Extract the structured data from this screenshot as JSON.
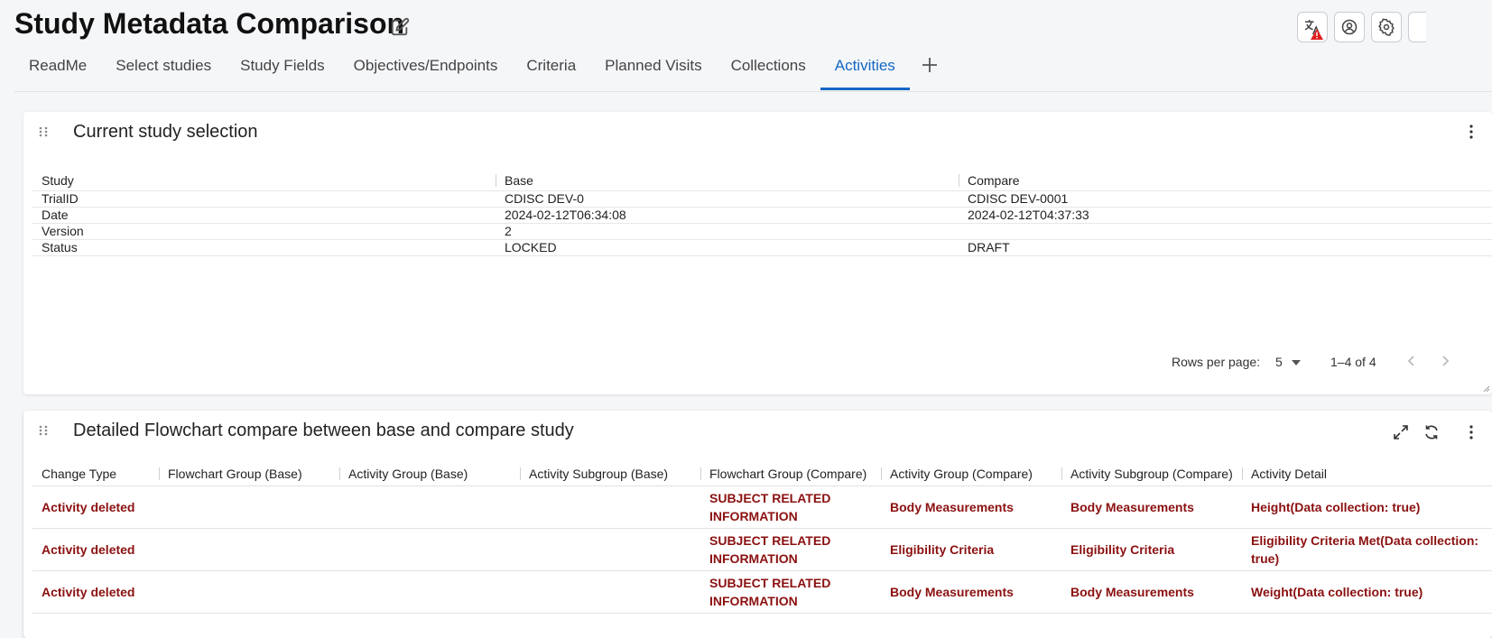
{
  "page": {
    "title": "Study Metadata Comparison"
  },
  "tabs": [
    {
      "label": "ReadMe"
    },
    {
      "label": "Select studies"
    },
    {
      "label": "Study Fields"
    },
    {
      "label": "Objectives/Endpoints"
    },
    {
      "label": "Criteria"
    },
    {
      "label": "Planned Visits"
    },
    {
      "label": "Collections"
    },
    {
      "label": "Activities"
    }
  ],
  "active_tab": "Activities",
  "icons": {
    "edit": "pencil-icon",
    "translate": "translate-icon",
    "account": "account-icon",
    "settings": "gear-icon",
    "add_tab": "plus-icon",
    "drag": "drag-handle-icon",
    "menu": "kebab-menu-icon",
    "expand": "expand-icon",
    "refresh": "refresh-icon"
  },
  "colors": {
    "accent": "#1467c5",
    "deleted_text": "#8b1010",
    "warning": "#e02020"
  },
  "selection_card": {
    "title": "Current study selection",
    "columns": [
      "Study",
      "Base",
      "Compare"
    ],
    "rows": [
      [
        "TrialID",
        "CDISC DEV-0",
        "CDISC DEV-0001"
      ],
      [
        "Date",
        "2024-02-12T06:34:08",
        "2024-02-12T04:37:33"
      ],
      [
        "Version",
        "2",
        ""
      ],
      [
        "Status",
        "LOCKED",
        "DRAFT"
      ]
    ],
    "pagination": {
      "rows_per_page_label": "Rows per page:",
      "rows_per_page_value": "5",
      "range_text": "1–4 of 4"
    }
  },
  "flowchart_card": {
    "title": "Detailed Flowchart compare between base and compare study",
    "columns": [
      "Change Type",
      "Flowchart Group (Base)",
      "Activity Group (Base)",
      "Activity Subgroup (Base)",
      "Flowchart Group (Compare)",
      "Activity Group (Compare)",
      "Activity Subgroup (Compare)",
      "Activity Detail"
    ],
    "rows": [
      [
        "Activity deleted",
        "",
        "",
        "",
        "SUBJECT RELATED INFORMATION",
        "Body Measurements",
        "Body Measurements",
        "Height(Data collection: true)"
      ],
      [
        "Activity deleted",
        "",
        "",
        "",
        "SUBJECT RELATED INFORMATION",
        "Eligibility Criteria",
        "Eligibility Criteria",
        "Eligibility Criteria Met(Data collection: true)"
      ],
      [
        "Activity deleted",
        "",
        "",
        "",
        "SUBJECT RELATED INFORMATION",
        "Body Measurements",
        "Body Measurements",
        "Weight(Data collection: true)"
      ]
    ]
  }
}
